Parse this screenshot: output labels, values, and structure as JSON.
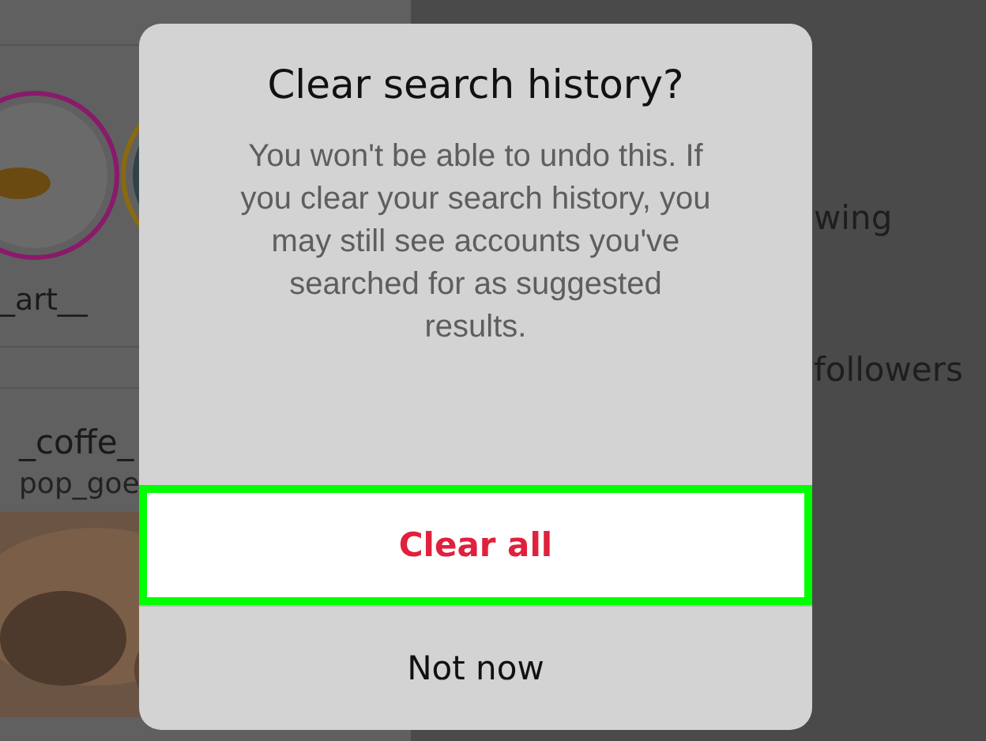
{
  "background": {
    "stories": [
      {
        "label": "_art__"
      }
    ],
    "account": {
      "username": "_coffe_",
      "subtitle": "pop_goe"
    },
    "stats": [
      "wing",
      "followers"
    ]
  },
  "dialog": {
    "title": "Clear search history?",
    "message": "You won't be able to undo this. If you clear your search history, you may still see accounts you've searched for as suggested results.",
    "buttons": [
      {
        "label": "Clear all",
        "kind": "destructive",
        "highlighted": true
      },
      {
        "label": "Not now",
        "kind": "plain",
        "highlighted": false
      }
    ]
  }
}
